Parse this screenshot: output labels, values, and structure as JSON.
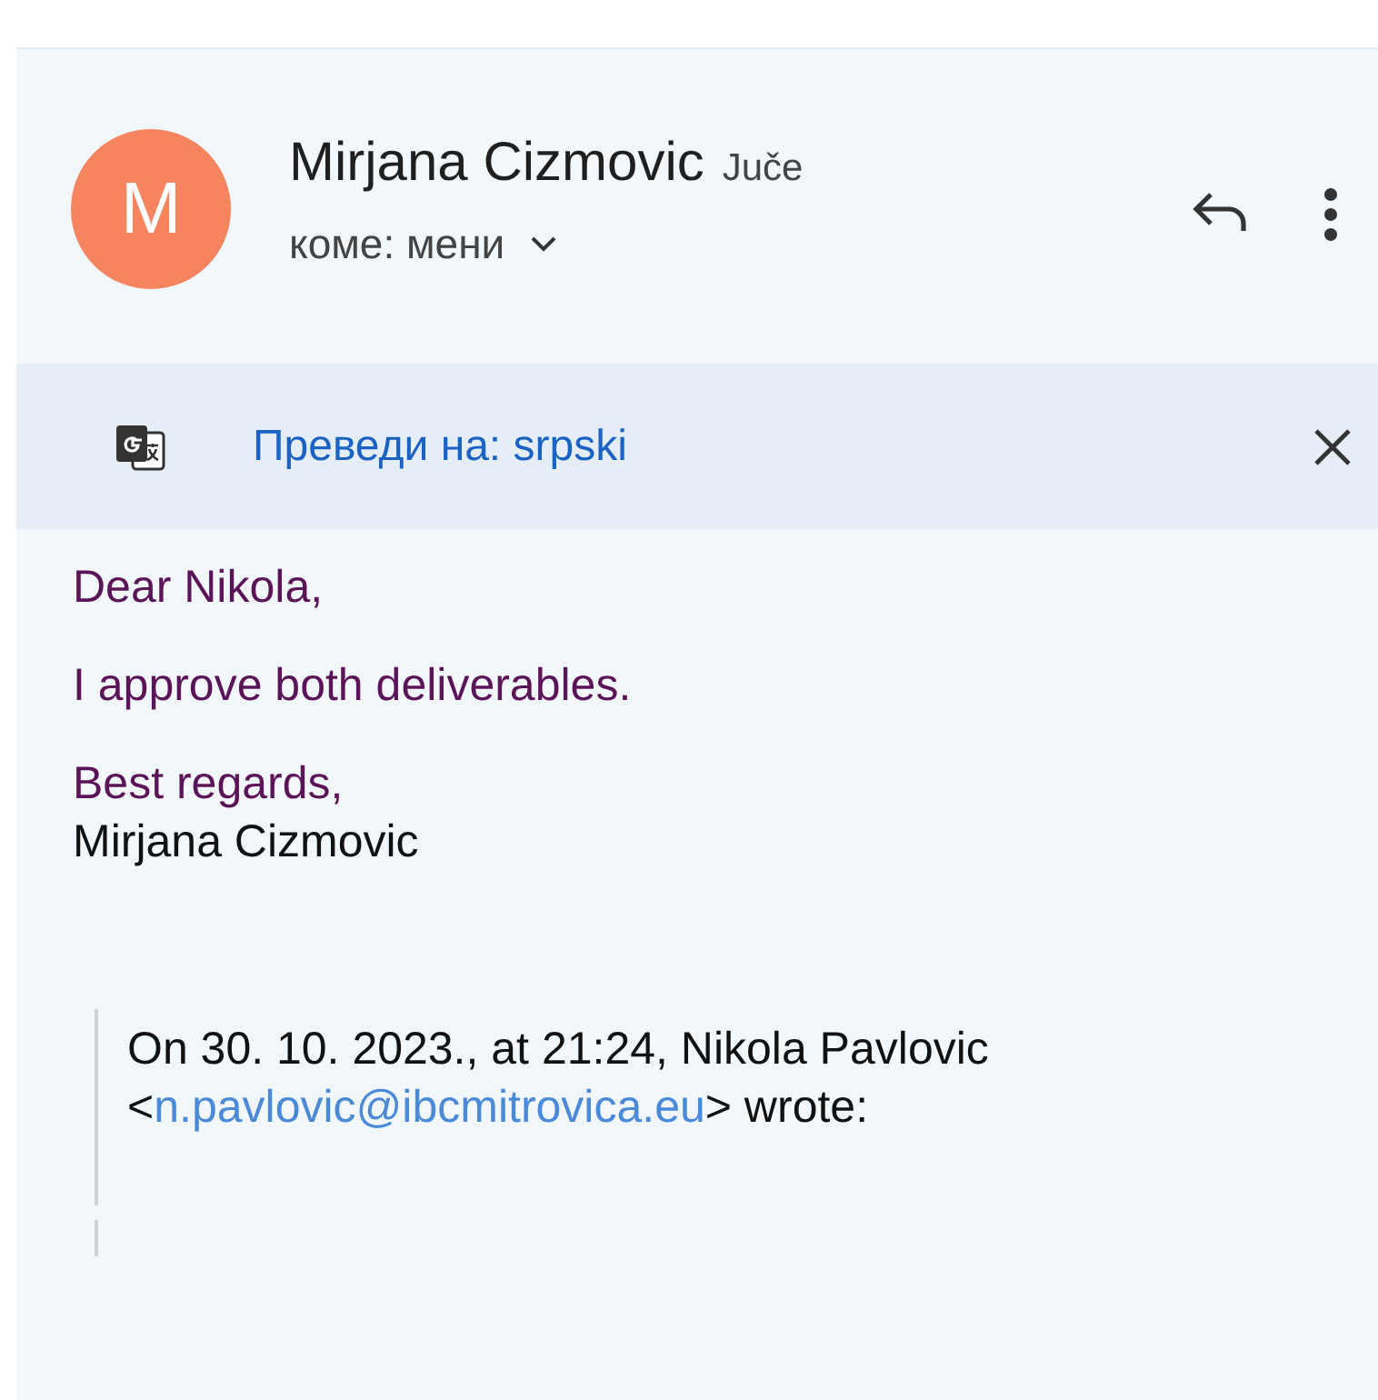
{
  "header": {
    "avatar_letter": "M",
    "sender": "Mirjana Cizmovic",
    "date": "Juče",
    "recipient": "коме: мени"
  },
  "translate_bar": {
    "label": "Преведи на: srpski"
  },
  "body": [
    {
      "lines": [
        {
          "text": "Dear Nikola,",
          "kind": "reply"
        }
      ]
    },
    {
      "lines": [
        {
          "text": "I approve both deliverables.",
          "kind": "reply"
        }
      ]
    },
    {
      "lines": [
        {
          "text": "Best regards,",
          "kind": "reply"
        },
        {
          "text": "Mirjana Cizmovic",
          "kind": "signature"
        }
      ]
    }
  ],
  "quote": {
    "intro": "On 30. 10. 2023., at 21:24, Nikola Pavlovic",
    "open": "<",
    "email": "n.pavlovic@ibcmitrovica.eu",
    "close": "> wrote:"
  }
}
